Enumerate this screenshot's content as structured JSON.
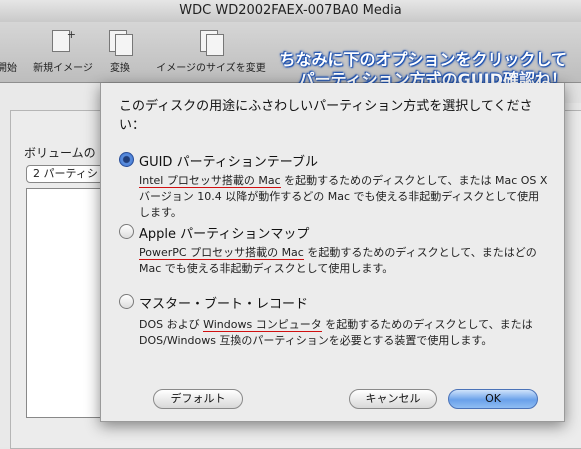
{
  "window": {
    "title": "WDC WD2002FAEX-007BA0 Media"
  },
  "toolbar": {
    "items": [
      {
        "label": "開始"
      },
      {
        "label": "新規イメージ"
      },
      {
        "label": "変換"
      },
      {
        "label": "イメージのサイズを変更"
      }
    ]
  },
  "annotation": {
    "line1": "ちなみに下のオプションをクリックして",
    "line2": "パーティション方式のGUID確認ね！"
  },
  "background": {
    "volume_label": "ボリュームの",
    "scheme_select": "2 パーティシ"
  },
  "dialog": {
    "prompt": "このディスクの用途にふさわしいパーティション方式を選択してください：",
    "options": [
      {
        "title": "GUID パーティションテーブル",
        "selected": true,
        "desc_a": "Intel プロセッサ搭載の Mac",
        "desc_b": " を起動するためのディスクとして、または Mac OS X バージョン 10.4 以降が動作するどの Mac でも使える非起動ディスクとして使用します。"
      },
      {
        "title": "Apple パーティションマップ",
        "selected": false,
        "desc_a": "PowerPC プロセッサ搭載の Mac",
        "desc_b": " を起動するためのディスクとして、またはどの Mac でも使える非起動ディスクとして使用します。"
      },
      {
        "title": "マスター・ブート・レコード",
        "selected": false,
        "desc_pre": "DOS および ",
        "desc_a": "Windows コンピュータ",
        "desc_b": " を起動するためのディスクとして、または DOS/Windows 互換のパーティションを必要とする装置で使用します。"
      }
    ],
    "buttons": {
      "default": "デフォルト",
      "cancel": "キャンセル",
      "ok": "OK"
    }
  }
}
